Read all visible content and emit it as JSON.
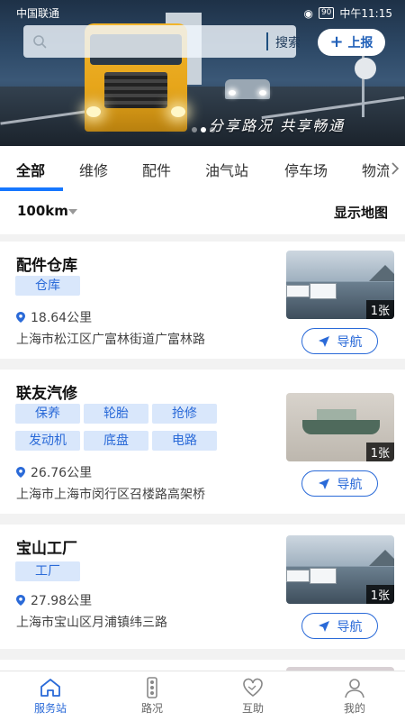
{
  "status_bar": {
    "carrier": "中国联通",
    "battery": "90",
    "time": "中午11:15"
  },
  "banner": {
    "slogan": "分享路况 共享畅通"
  },
  "search": {
    "placeholder": "",
    "button_label": "搜索"
  },
  "report_button": {
    "label": "上报"
  },
  "tabs": [
    {
      "label": "全部",
      "active": true
    },
    {
      "label": "维修"
    },
    {
      "label": "配件"
    },
    {
      "label": "油气站"
    },
    {
      "label": "停车场"
    },
    {
      "label": "物流"
    }
  ],
  "filter": {
    "distance": "100km",
    "map_toggle": "显示地图"
  },
  "list": [
    {
      "name": "配件仓库",
      "tags": [
        "仓库"
      ],
      "distance": "18.64公里",
      "address": "上海市松江区广富林街道广富林路",
      "photo_count": "1张",
      "nav_label": "导航"
    },
    {
      "name": "联友汽修",
      "tags": [
        "保养",
        "轮胎",
        "抢修",
        "发动机",
        "底盘",
        "电路"
      ],
      "distance": "26.76公里",
      "address": "上海市上海市闵行区召楼路高架桥",
      "photo_count": "1张",
      "nav_label": "导航"
    },
    {
      "name": "宝山工厂",
      "tags": [
        "工厂"
      ],
      "distance": "27.98公里",
      "address": "上海市宝山区月浦镇纬三路",
      "photo_count": "1张",
      "nav_label": "导航"
    }
  ],
  "bottom_nav": [
    {
      "label": "服务站",
      "icon": "home-icon",
      "active": true
    },
    {
      "label": "路况",
      "icon": "traffic-light-icon"
    },
    {
      "label": "互助",
      "icon": "heart-handshake-icon"
    },
    {
      "label": "我的",
      "icon": "user-icon"
    }
  ],
  "colors": {
    "accent": "#2a6ad8",
    "tab_underline": "#1677ff",
    "tag_bg": "#d9e7fb"
  }
}
